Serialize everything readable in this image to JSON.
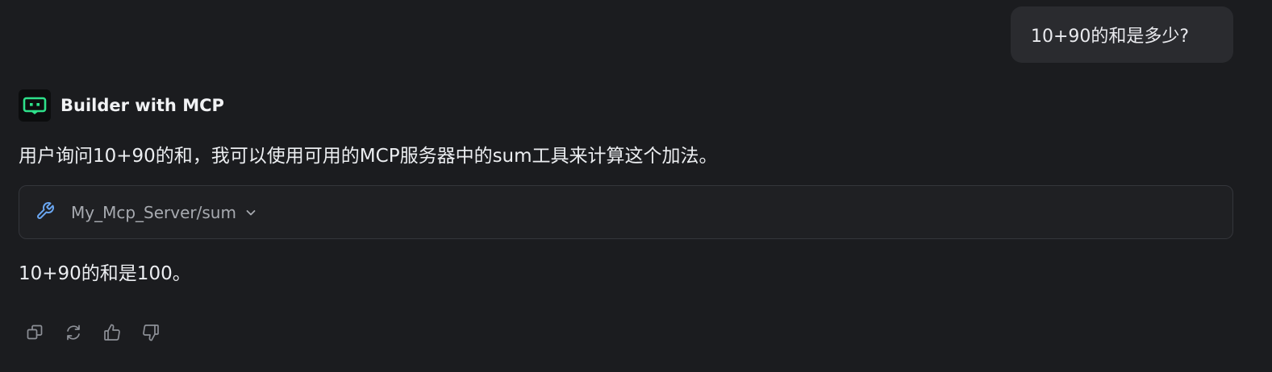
{
  "conversation": {
    "user_message": "10+90的和是多少?",
    "assistant": {
      "name": "Builder with MCP",
      "avatar_icon": "robot-icon",
      "avatar_accent": "#2ee08a",
      "thinking_text": "用户询问10+90的和，我可以使用可用的MCP服务器中的sum工具来计算这个加法。",
      "tool_call": {
        "icon": "wrench-icon",
        "icon_color": "#6aa7f2",
        "label": "My_Mcp_Server/sum",
        "toggle_icon": "chevron-down-icon"
      },
      "answer_text": "10+90的和是100。"
    },
    "actions": [
      {
        "name": "copy",
        "icon": "copy-icon"
      },
      {
        "name": "regenerate",
        "icon": "refresh-icon"
      },
      {
        "name": "like",
        "icon": "thumbs-up-icon"
      },
      {
        "name": "dislike",
        "icon": "thumbs-down-icon"
      }
    ]
  }
}
